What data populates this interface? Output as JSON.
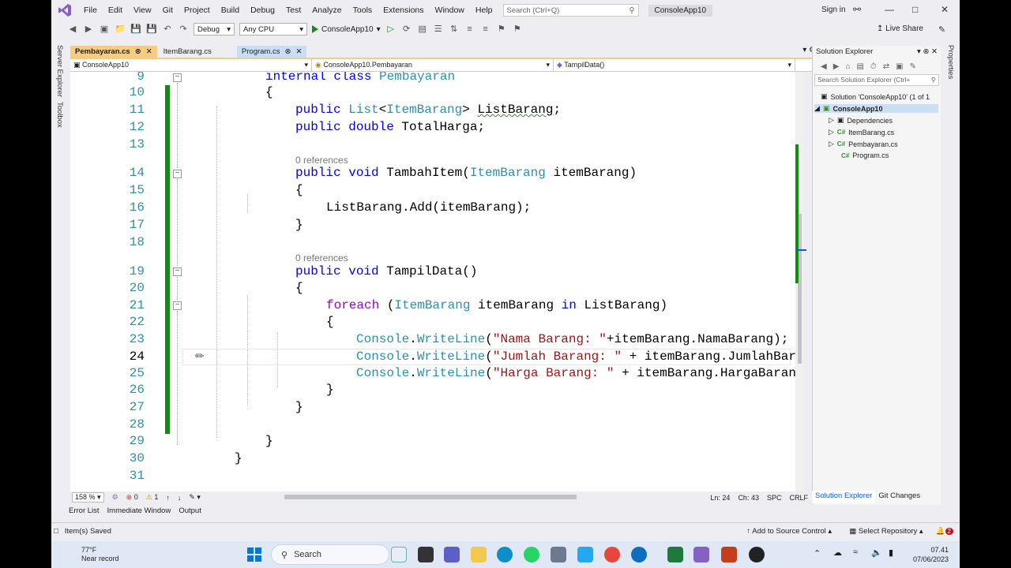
{
  "menu": {
    "items": [
      "File",
      "Edit",
      "View",
      "Git",
      "Project",
      "Build",
      "Debug",
      "Test",
      "Analyze",
      "Tools",
      "Extensions",
      "Window",
      "Help"
    ],
    "search_placeholder": "Search (Ctrl+Q)",
    "app_title": "ConsoleApp10",
    "sign_in": "Sign in"
  },
  "toolbar": {
    "config": "Debug",
    "platform": "Any CPU",
    "run_target": "ConsoleApp10",
    "live_share": "Live Share"
  },
  "side_left": {
    "server_explorer": "Server Explorer",
    "toolbox": "Toolbox"
  },
  "side_right": {
    "properties": "Properties"
  },
  "tabs": [
    {
      "label": "Pembayaran.cs",
      "state": "active"
    },
    {
      "label": "ItemBarang.cs",
      "state": "normal"
    },
    {
      "label": "Program.cs",
      "state": "hover"
    }
  ],
  "navbar": {
    "project": "ConsoleApp10",
    "type": "ConsoleApp10.Pembayaran",
    "member": "TampilData()"
  },
  "editor": {
    "line_numbers": [
      "9",
      "10",
      "11",
      "12",
      "13",
      "14",
      "15",
      "16",
      "17",
      "18",
      "19",
      "20",
      "21",
      "22",
      "23",
      "24",
      "25",
      "26",
      "27",
      "28",
      "29",
      "30",
      "31"
    ],
    "current_line": "24",
    "references_label": "0 references"
  },
  "status_row": {
    "zoom": "158 %",
    "errors": "0",
    "warnings": "1",
    "line": "Ln: 24",
    "col": "Ch: 43",
    "spc": "SPC",
    "eol": "CRLF"
  },
  "bottom_tabs": [
    "Error List",
    "Immediate Window",
    "Output"
  ],
  "statusbar": {
    "message": "Item(s) Saved",
    "source_control": "Add to Source Control",
    "repo": "Select Repository",
    "notifications": "2"
  },
  "solution_explorer": {
    "title": "Solution Explorer",
    "search_placeholder": "Search Solution Explorer (Ctrl+",
    "solution": "Solution 'ConsoleApp10' (1 of 1",
    "project": "ConsoleApp10",
    "items": [
      "Dependencies",
      "ItemBarang.cs",
      "Pembayaran.cs",
      "Program.cs"
    ],
    "cs_badge": "C#",
    "bottom_tabs": [
      "Solution Explorer",
      "Git Changes"
    ]
  },
  "taskbar": {
    "temp": "77°F",
    "weather": "Near record",
    "search": "Search",
    "time": "07.41",
    "date": "07/06/2023"
  },
  "colors": {
    "active_tab": "#f5cc84",
    "keyword": "#0000ff",
    "type": "#2b91af",
    "control_keyword": "#8f08c4",
    "string": "#a31515",
    "change_bar": "#108c10"
  }
}
